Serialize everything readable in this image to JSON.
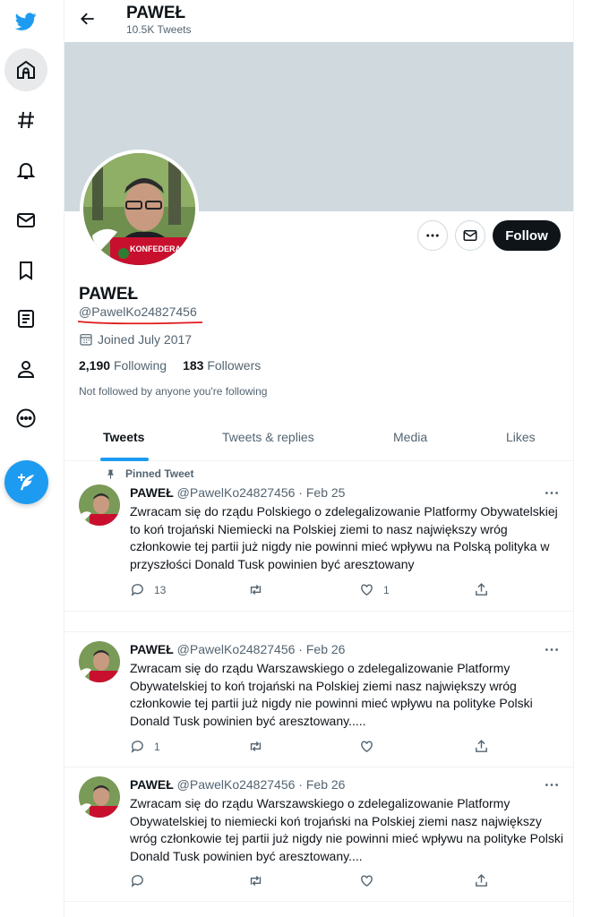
{
  "nav": {
    "items": [
      "twitter-logo",
      "home",
      "explore",
      "notifications",
      "messages",
      "bookmarks",
      "lists",
      "profile",
      "more"
    ]
  },
  "header": {
    "name": "PAWEŁ",
    "tweet_count": "10.5K Tweets"
  },
  "profile": {
    "name": "PAWEŁ",
    "handle": "@PawelKo24827456",
    "joined": "Joined July 2017",
    "following_count": "2,190",
    "following_label": "Following",
    "followers_count": "183",
    "followers_label": "Followers",
    "not_followed": "Not followed by anyone you're following",
    "follow_label": "Follow",
    "avatar_badge": "KONFEDERACJA"
  },
  "tabs": [
    {
      "label": "Tweets",
      "active": true
    },
    {
      "label": "Tweets & replies",
      "active": false
    },
    {
      "label": "Media",
      "active": false
    },
    {
      "label": "Likes",
      "active": false
    }
  ],
  "tweets": [
    {
      "pinned_label": "Pinned Tweet",
      "name": "PAWEŁ",
      "handle": "@PawelKo24827456",
      "sep": " · ",
      "date": "Feb 25",
      "text": "Zwracam się do rządu Polskiego o zdelegalizowanie Platformy Obywatelskiej to koń trojański Niemiecki na Polskiej ziemi to nasz największy wróg członkowie tej partii już nigdy nie powinni mieć wpływu na Polską polityka w przyszłości Donald Tusk powinien być aresztowany",
      "replies": "13",
      "retweets": "",
      "likes": "1"
    },
    {
      "name": "PAWEŁ",
      "handle": "@PawelKo24827456",
      "sep": " · ",
      "date": "Feb 26",
      "text": "Zwracam się do rządu Warszawskiego o zdelegalizowanie Platformy Obywatelskiej to koń trojański na Polskiej ziemi nasz największy wróg członkowie tej partii już nigdy nie powinni mieć wpływu na polityke Polski Donald Tusk powinien być aresztowany.....",
      "replies": "1",
      "retweets": "",
      "likes": ""
    },
    {
      "name": "PAWEŁ",
      "handle": "@PawelKo24827456",
      "sep": " · ",
      "date": "Feb 26",
      "text": "Zwracam się do rządu Warszawskiego o zdelegalizowanie Platformy Obywatelskiej to niemiecki koń trojański na Polskiej ziemi nasz największy wróg członkowie tej partii już nigdy nie powinni mieć wpływu na polityke Polski Donald Tusk powinien być aresztowany....",
      "replies": "",
      "retweets": "",
      "likes": ""
    }
  ],
  "colors": {
    "accent": "#1d9bf0",
    "annotation_underline": "#e0191c"
  }
}
